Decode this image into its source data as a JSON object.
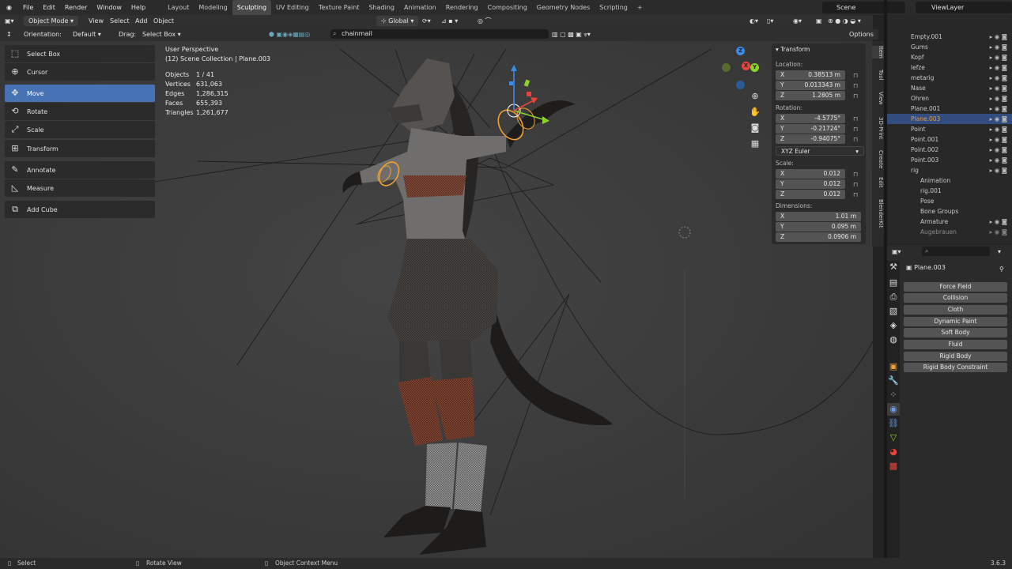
{
  "topbar": {
    "menus": [
      "File",
      "Edit",
      "Render",
      "Window",
      "Help"
    ],
    "workspaces": [
      "Layout",
      "Modeling",
      "Sculpting",
      "UV Editing",
      "Texture Paint",
      "Shading",
      "Animation",
      "Rendering",
      "Compositing",
      "Geometry Nodes",
      "Scripting"
    ],
    "active_workspace": "Sculpting",
    "add_tab": "+",
    "scene": "Scene",
    "view_layer": "ViewLayer"
  },
  "header": {
    "mode": "Object Mode",
    "menus": [
      "View",
      "Select",
      "Add",
      "Object"
    ],
    "transform_orientation": "Global",
    "search_value": "chainmail"
  },
  "tool_settings": {
    "orientation_label": "Orientation:",
    "orientation_value": "Default",
    "drag_label": "Drag:",
    "drag_value": "Select Box",
    "options": "Options"
  },
  "toolbar": {
    "tools": [
      {
        "label": "Select Box",
        "icon": "select-box-icon"
      },
      {
        "label": "Cursor",
        "icon": "cursor-icon"
      },
      {
        "label": "Move",
        "icon": "move-icon"
      },
      {
        "label": "Rotate",
        "icon": "rotate-icon"
      },
      {
        "label": "Scale",
        "icon": "scale-icon"
      },
      {
        "label": "Transform",
        "icon": "transform-icon"
      },
      {
        "label": "Annotate",
        "icon": "annotate-icon"
      },
      {
        "label": "Measure",
        "icon": "measure-icon"
      },
      {
        "label": "Add Cube",
        "icon": "add-cube-icon"
      }
    ],
    "active_tool": "Move"
  },
  "viewport_info": {
    "view_name": "User Perspective",
    "collection": "(12) Scene Collection | Plane.003",
    "stats": [
      {
        "label": "Objects",
        "value": "1 / 41"
      },
      {
        "label": "Vertices",
        "value": "631,063"
      },
      {
        "label": "Edges",
        "value": "1,286,315"
      },
      {
        "label": "Faces",
        "value": "655,393"
      },
      {
        "label": "Triangles",
        "value": "1,261,677"
      }
    ]
  },
  "transform_panel": {
    "title": "Transform",
    "location_label": "Location:",
    "location": [
      {
        "axis": "X",
        "value": "0.38513 m"
      },
      {
        "axis": "Y",
        "value": "0.013343 m"
      },
      {
        "axis": "Z",
        "value": "1.2805 m"
      }
    ],
    "rotation_label": "Rotation:",
    "rotation": [
      {
        "axis": "X",
        "value": "-4.5775°"
      },
      {
        "axis": "Y",
        "value": "-0.21724°"
      },
      {
        "axis": "Z",
        "value": "-0.94075°"
      }
    ],
    "rotation_mode": "XYZ Euler",
    "scale_label": "Scale:",
    "scale": [
      {
        "axis": "X",
        "value": "0.012"
      },
      {
        "axis": "Y",
        "value": "0.012"
      },
      {
        "axis": "Z",
        "value": "0.012"
      }
    ],
    "dimensions_label": "Dimensions:",
    "dimensions": [
      {
        "axis": "X",
        "value": "1.01 m"
      },
      {
        "axis": "Y",
        "value": "0.095 m"
      },
      {
        "axis": "Z",
        "value": "0.0906 m"
      }
    ]
  },
  "sidebar_tabs": [
    "Item",
    "Tool",
    "View",
    "3D-Print",
    "Create",
    "Edit",
    "BlenderKit"
  ],
  "gizmo_axes": [
    "Z",
    "Y",
    "X"
  ],
  "outliner": {
    "items": [
      {
        "name": "Empty.001",
        "indent": 1
      },
      {
        "name": "Gums",
        "indent": 1
      },
      {
        "name": "Kopf",
        "indent": 1
      },
      {
        "name": "lefze",
        "indent": 1
      },
      {
        "name": "metarig",
        "indent": 1
      },
      {
        "name": "Nase",
        "indent": 1
      },
      {
        "name": "Ohren",
        "indent": 1
      },
      {
        "name": "Plane.001",
        "indent": 1
      },
      {
        "name": "Plane.003",
        "indent": 1
      },
      {
        "name": "Point",
        "indent": 1
      },
      {
        "name": "Point.001",
        "indent": 1
      },
      {
        "name": "Point.002",
        "indent": 1
      },
      {
        "name": "Point.003",
        "indent": 1
      },
      {
        "name": "rig",
        "indent": 1
      },
      {
        "name": "Animation",
        "indent": 2
      },
      {
        "name": "rig.001",
        "indent": 2
      },
      {
        "name": "Pose",
        "indent": 2
      },
      {
        "name": "Bone Groups",
        "indent": 2
      },
      {
        "name": "Armature",
        "indent": 2
      },
      {
        "name": "Augebrauen",
        "indent": 2
      }
    ],
    "selected": "Plane.003"
  },
  "properties": {
    "object_name": "Plane.003",
    "physics_buttons": [
      "Force Field",
      "Collision",
      "Cloth",
      "Dynamic Paint",
      "Soft Body",
      "Fluid",
      "Rigid Body",
      "Rigid Body Constraint"
    ]
  },
  "statusbar": {
    "select": "Select",
    "rotate": "Rotate View",
    "context": "Object Context Menu",
    "version": "3.6.3"
  },
  "colors": {
    "accent": "#4772b3",
    "selection_orange": "#e29a3a",
    "viewport_bg": "#3f3f3f"
  }
}
